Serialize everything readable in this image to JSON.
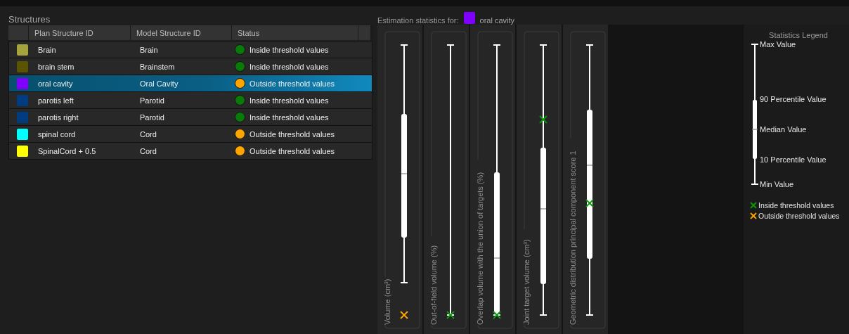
{
  "structures": {
    "title": "Structures",
    "columns": [
      "Plan Structure ID",
      "Model Structure ID",
      "Status"
    ],
    "rows": [
      {
        "plan_id": "Brain",
        "model_id": "Brain",
        "color": "#a8a43c",
        "kind": "inside",
        "status_label": "Inside threshold values",
        "selected": false
      },
      {
        "plan_id": "brain stem",
        "model_id": "Brainstem",
        "color": "#5a5400",
        "kind": "inside",
        "status_label": "Inside threshold values",
        "selected": false
      },
      {
        "plan_id": "oral cavity",
        "model_id": "Oral Cavity",
        "color": "#8000ff",
        "kind": "outside",
        "status_label": "Outside threshold values",
        "selected": true
      },
      {
        "plan_id": "parotis left",
        "model_id": "Parotid",
        "color": "#003d80",
        "kind": "inside",
        "status_label": "Inside threshold values",
        "selected": false
      },
      {
        "plan_id": "parotis right",
        "model_id": "Parotid",
        "color": "#003d80",
        "kind": "inside",
        "status_label": "Inside threshold values",
        "selected": false
      },
      {
        "plan_id": "spinal cord",
        "model_id": "Cord",
        "color": "#00ffff",
        "kind": "outside",
        "status_label": "Outside threshold values",
        "selected": false
      },
      {
        "plan_id": "SpinalCord + 0.5",
        "model_id": "Cord",
        "color": "#ffff00",
        "kind": "outside",
        "status_label": "Outside threshold values",
        "selected": false
      }
    ]
  },
  "estimation": {
    "label": "Estimation statistics for:",
    "structure": {
      "name": "oral cavity",
      "color": "#8000ff"
    },
    "plots": [
      {
        "label": "Volume (cm³)",
        "marker": {
          "kind": "outside",
          "level": 0
        }
      },
      {
        "label": "Out-of-field volume (%)",
        "marker": {
          "kind": "inside",
          "level": 0
        }
      },
      {
        "label": "Overlap volume with the union of targets (%)",
        "marker": {
          "kind": "inside",
          "level": 0
        }
      },
      {
        "label": "Joint target volume (cm³)",
        "marker": {
          "kind": "inside",
          "level": 0.724
        }
      },
      {
        "label": "Geometric distribution principal component score 1",
        "marker": {
          "kind": "inside",
          "level": 0.414
        }
      }
    ]
  },
  "legend": {
    "title": "Statistics Legend",
    "stats": [
      "Max Value",
      "90 Percentile Value",
      "Median Value",
      "10 Percentile Value",
      "Min Value"
    ],
    "markers": [
      {
        "kind": "inside",
        "label": "Inside threshold values"
      },
      {
        "kind": "outside",
        "label": "Outside threshold values"
      }
    ]
  }
}
